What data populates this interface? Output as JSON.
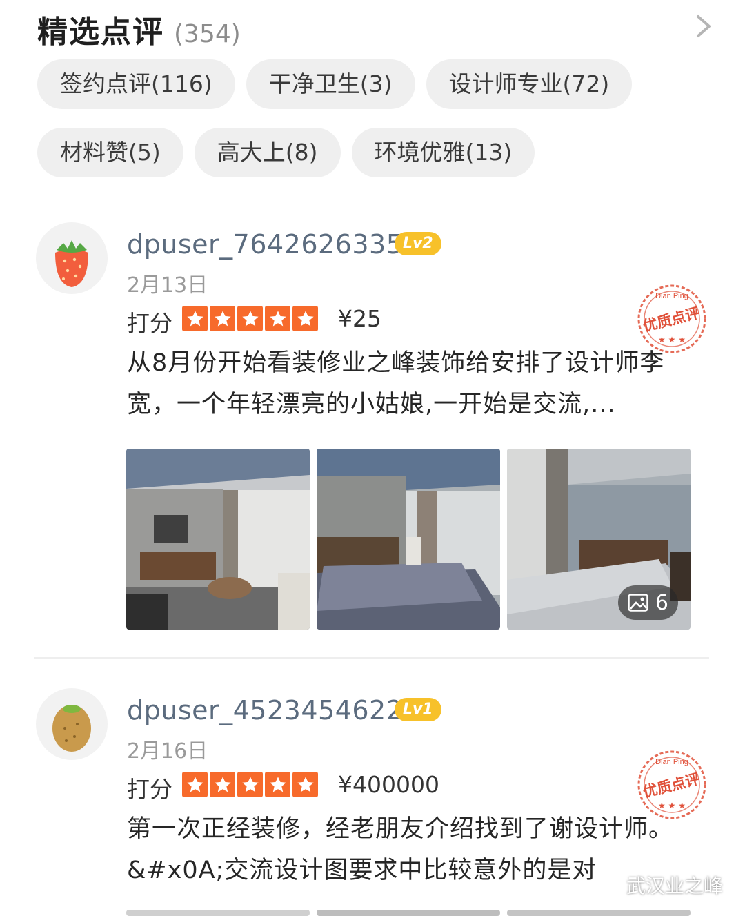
{
  "header": {
    "title": "精选点评",
    "count": "(354)"
  },
  "tags": [
    [
      {
        "label": "签约点评(116)"
      },
      {
        "label": "干净卫生(3)"
      },
      {
        "label": "设计师专业(72)"
      }
    ],
    [
      {
        "label": "材料赞(5)"
      },
      {
        "label": "高大上(8)"
      },
      {
        "label": "环境优雅(13)"
      }
    ]
  ],
  "reviews": [
    {
      "username": "dpuser_7642626335",
      "level": "Lv2",
      "date": "2月13日",
      "score_label": "打分",
      "rating": 5,
      "price": "¥25",
      "text": "从8月份开始看装修业之峰装饰给安排了设计师李宽，一个年轻漂亮的小姑娘,一开始是交流,...",
      "photo_count": "6",
      "avatar_icon": "strawberry-icon",
      "stamp_label": "优质点评",
      "stamp_small": "Dian Ping"
    },
    {
      "username": "dpuser_4523454622",
      "level": "Lv1",
      "date": "2月16日",
      "score_label": "打分",
      "rating": 5,
      "price": "¥400000",
      "text": "第一次正经装修，经老朋友介绍找到了谢设计师。&#x0A;交流设计图要求中比较意外的是对",
      "avatar_icon": "kiwi-icon",
      "stamp_label": "优质点评",
      "stamp_small": "Dian Ping"
    }
  ],
  "watermark": {
    "text": "武汉业之峰"
  },
  "colors": {
    "accent": "#f76a2b",
    "level_badge": "#f7c12a",
    "username": "#5b6b7e",
    "stamp": "#e0513a"
  }
}
